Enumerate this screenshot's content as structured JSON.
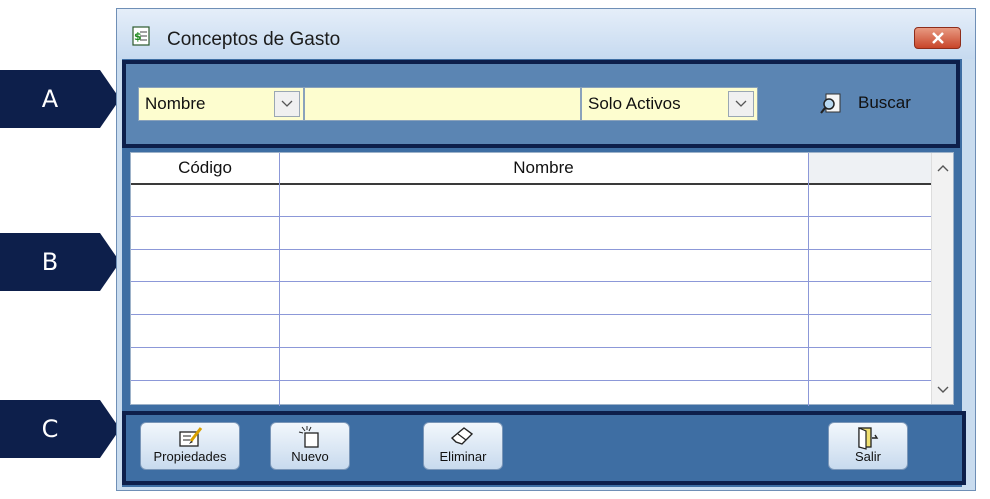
{
  "callouts": [
    "A",
    "B",
    "C"
  ],
  "window": {
    "title": "Conceptos de Gasto",
    "close": "×"
  },
  "search": {
    "field_selector": "Nombre",
    "search_value": "",
    "status_filter": "Solo Activos",
    "search_button": "Buscar"
  },
  "grid": {
    "columns": [
      "Código",
      "Nombre",
      ""
    ],
    "rows": [
      [
        "",
        "",
        ""
      ],
      [
        "",
        "",
        ""
      ],
      [
        "",
        "",
        ""
      ],
      [
        "",
        "",
        ""
      ],
      [
        "",
        "",
        ""
      ],
      [
        "",
        "",
        ""
      ],
      [
        "",
        "",
        ""
      ]
    ]
  },
  "toolbar": {
    "properties": "Propiedades",
    "new": "Nuevo",
    "delete": "Eliminar",
    "exit": "Salir"
  },
  "colors": {
    "callout": "#0d1f4b",
    "client": "#3e6ea3",
    "field": "#fdfdcf",
    "close": "#c8452a"
  }
}
